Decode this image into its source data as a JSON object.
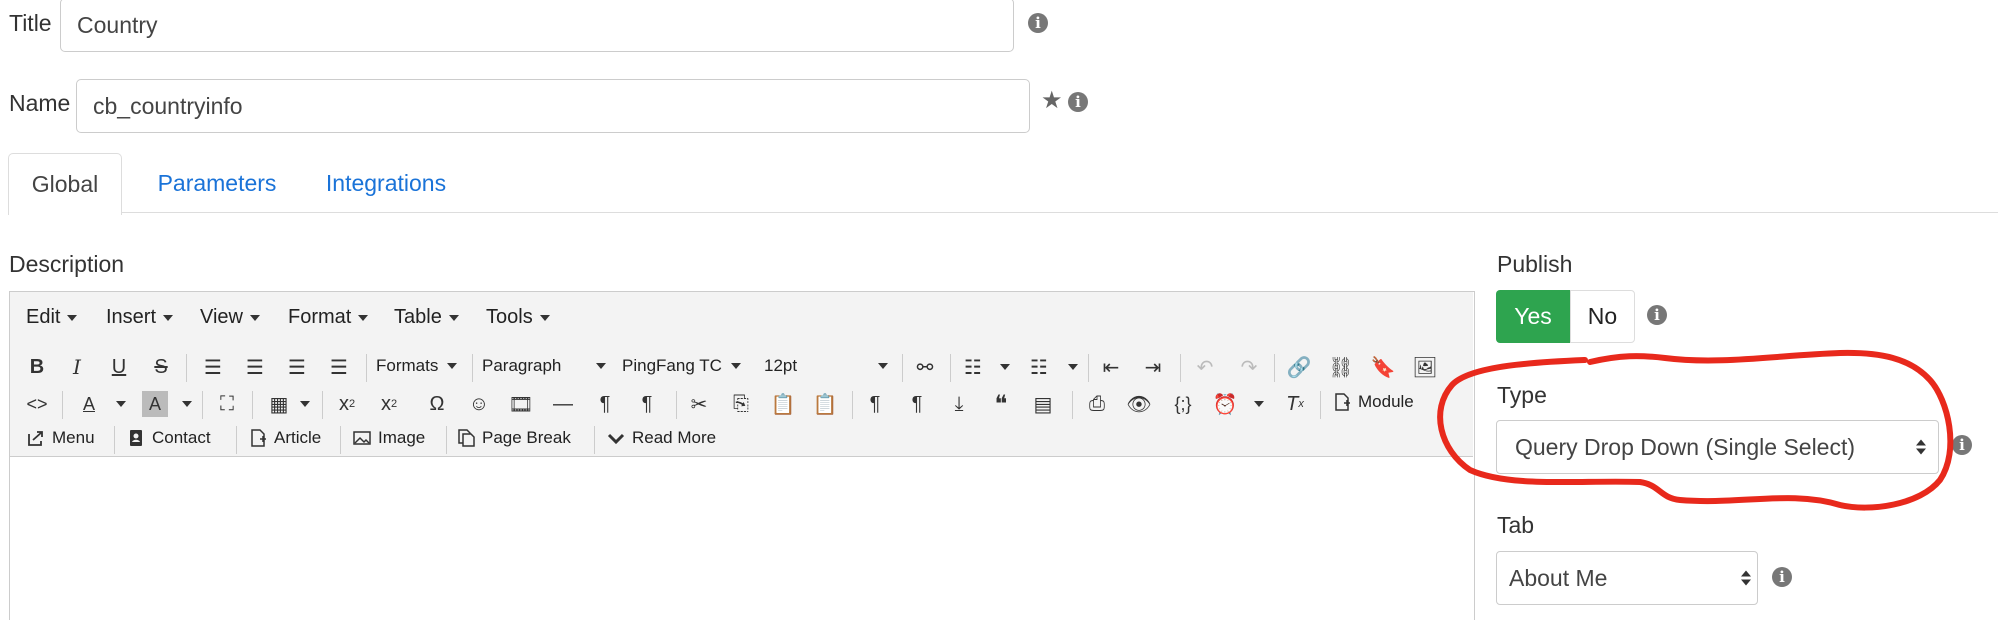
{
  "title": {
    "label": "Title",
    "value": "Country"
  },
  "name": {
    "label": "Name",
    "value": "cb_countryinfo"
  },
  "tabs": [
    {
      "label": "Global",
      "active": true
    },
    {
      "label": "Parameters",
      "active": false
    },
    {
      "label": "Integrations",
      "active": false
    }
  ],
  "description": {
    "label": "Description",
    "menubar": [
      "Edit",
      "Insert",
      "View",
      "Format",
      "Table",
      "Tools"
    ],
    "formats_label": "Formats",
    "paragraph_value": "Paragraph",
    "font_value": "PingFang TC",
    "size_value": "12pt",
    "module_label": "Module",
    "row3": {
      "menu": "Menu",
      "contact": "Contact",
      "article": "Article",
      "image": "Image",
      "page_break": "Page Break",
      "read_more": "Read More"
    }
  },
  "publish": {
    "label": "Publish",
    "yes": "Yes",
    "no": "No",
    "selected": "Yes"
  },
  "type": {
    "label": "Type",
    "value": "Query Drop Down (Single Select)"
  },
  "tab": {
    "label": "Tab",
    "value": "About Me"
  },
  "colors": {
    "accent": "#2ea44f",
    "link": "#1a73d8",
    "annotation": "#e8291c"
  }
}
